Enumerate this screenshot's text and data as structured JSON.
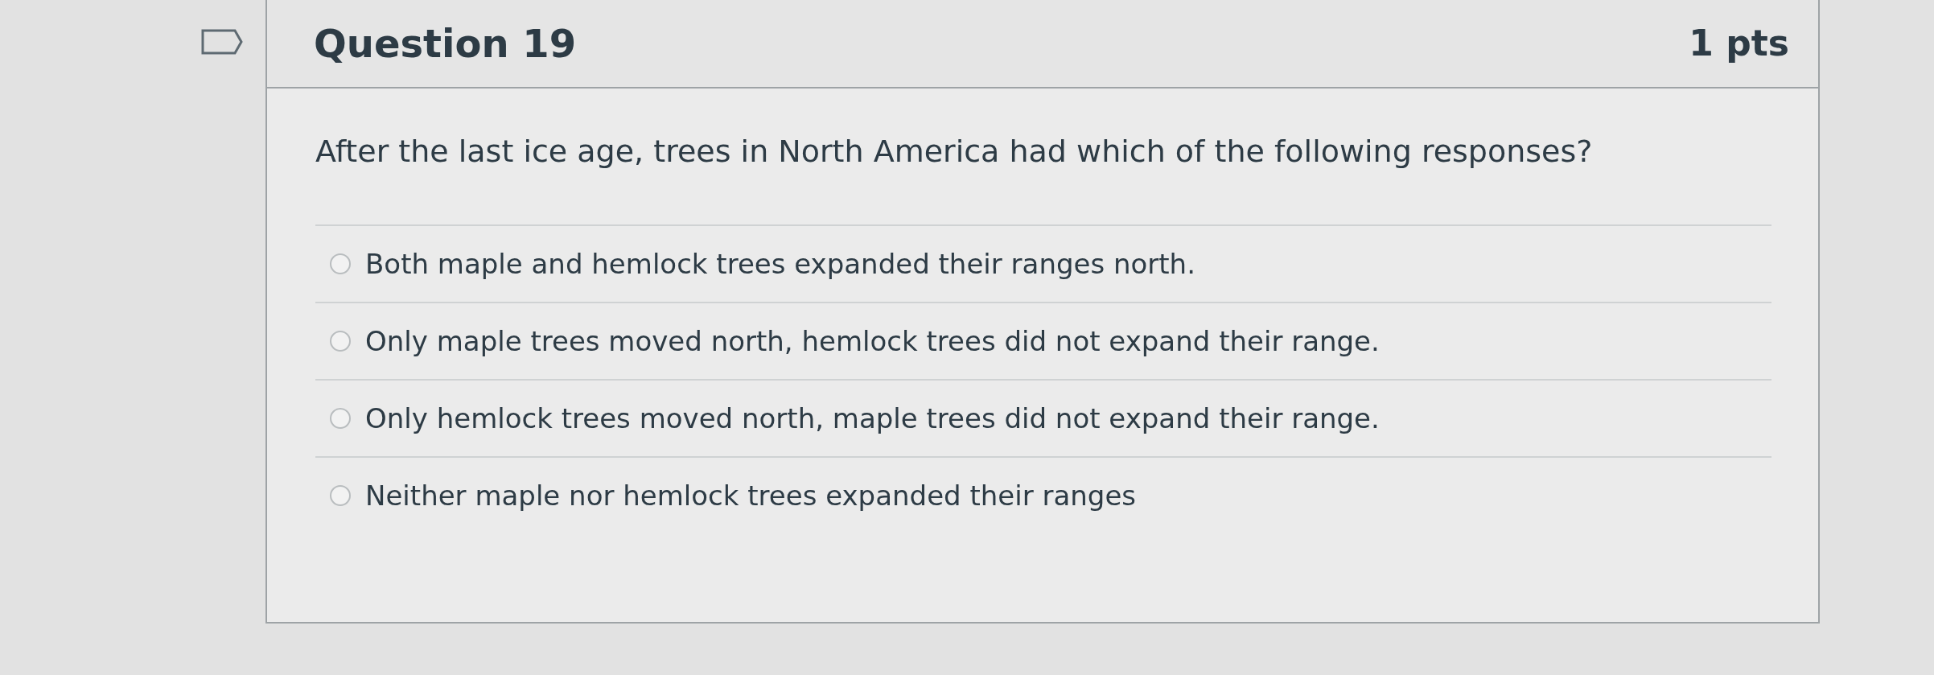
{
  "question": {
    "title": "Question 19",
    "points": "1 pts",
    "text": "After the last ice age, trees in North America had which of the following responses?",
    "answers": [
      {
        "label": "Both maple and hemlock trees expanded their ranges north.",
        "selected": false
      },
      {
        "label": "Only maple trees moved north, hemlock trees did not expand their range.",
        "selected": false
      },
      {
        "label": "Only hemlock trees moved north, maple trees did not expand their range.",
        "selected": false
      },
      {
        "label": "Neither maple nor hemlock trees expanded their ranges",
        "selected": false
      }
    ]
  }
}
